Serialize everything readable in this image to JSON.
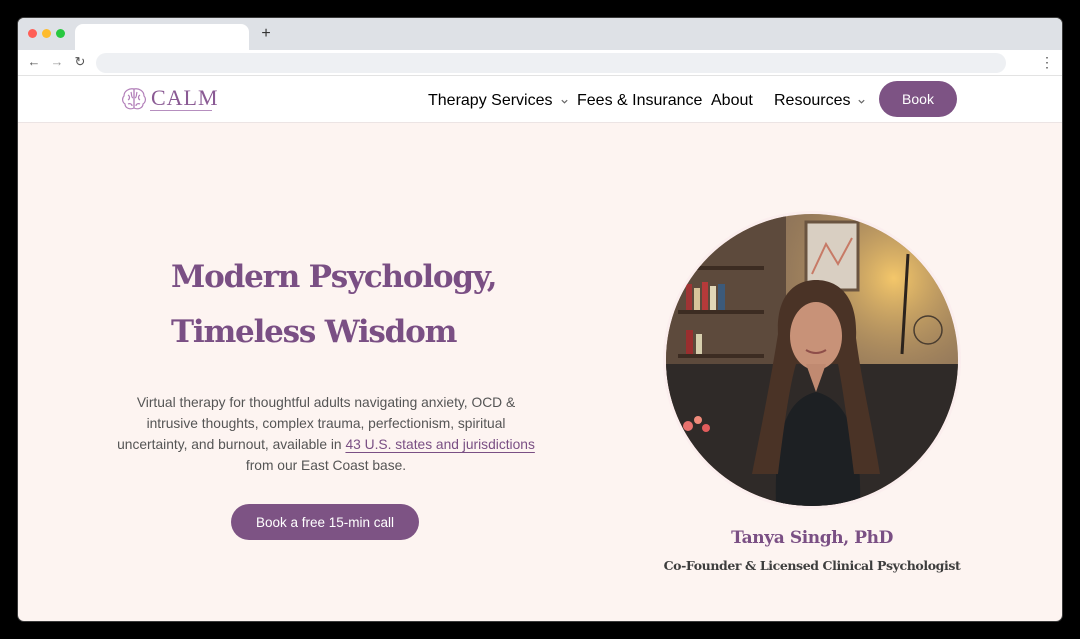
{
  "browser": {
    "new_tab_glyph": "+",
    "back_glyph": "←",
    "forward_glyph": "→",
    "reload_glyph": "↻",
    "menu_glyph": "⋮"
  },
  "header": {
    "logo_text": "CALM",
    "nav": [
      {
        "label": "Therapy Services",
        "has_dropdown": true
      },
      {
        "label": "Fees & Insurance",
        "has_dropdown": false
      },
      {
        "label": "About",
        "has_dropdown": false
      },
      {
        "label": "Resources",
        "has_dropdown": true
      }
    ],
    "book_label": "Book"
  },
  "hero": {
    "title_line1": "Modern Psychology,",
    "title_line2": "Timeless Wisdom",
    "text_before_link": "Virtual therapy for thoughtful adults navigating anxiety, OCD & intrusive thoughts, complex trauma, perfectionism, spiritual uncertainty, and burnout, available in ",
    "link_text": "43 U.S. states and jurisdictions",
    "text_after_link": " from our East Coast base.",
    "cta_label": "Book a free 15-min call"
  },
  "profile": {
    "name": "Tanya Singh, PhD",
    "role": "Co-Founder & Licensed Clinical Psychologist"
  },
  "colors": {
    "brand_purple": "#7d5384",
    "page_background": "#fdf4f1"
  }
}
